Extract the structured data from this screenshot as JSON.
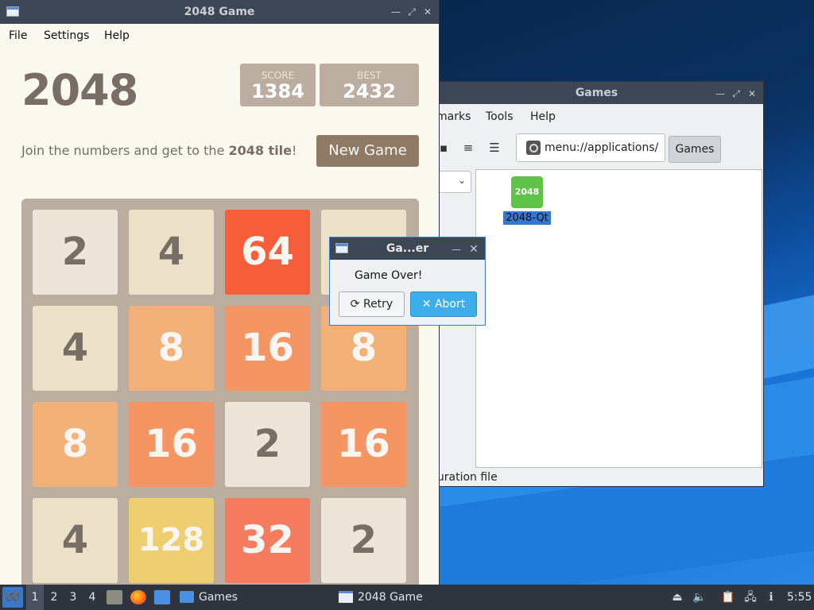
{
  "file_manager": {
    "title": "Games",
    "menu": [
      "marks",
      "Tools",
      "Help"
    ],
    "path": "menu://applications/",
    "breadcrumb": "Games",
    "file": {
      "icon_text": "2048",
      "name": "2048-Qt"
    },
    "status": "guration file"
  },
  "game": {
    "window_title": "2048 Game",
    "menu": [
      "File",
      "Settings",
      "Help"
    ],
    "title": "2048",
    "score_label": "SCORE",
    "score": "1384",
    "best_label": "BEST",
    "best": "2432",
    "intro_prefix": "Join the numbers and get to the ",
    "intro_bold": "2048 tile",
    "intro_suffix": "!",
    "new_game": "New Game",
    "tiles": [
      [
        "2",
        "4",
        "64",
        ""
      ],
      [
        "4",
        "8",
        "16",
        "8"
      ],
      [
        "8",
        "16",
        "2",
        "16"
      ],
      [
        "4",
        "128",
        "32",
        "2"
      ]
    ]
  },
  "dialog": {
    "title": "Ga...er",
    "message": "Game Over!",
    "retry": "Retry",
    "abort": "Abort"
  },
  "taskbar": {
    "workspaces": [
      "1",
      "2",
      "3",
      "4"
    ],
    "tasks": [
      "Games",
      "2048 Game"
    ],
    "clock": "5:55"
  },
  "colors": {
    "tile_2": "#eee4da",
    "tile_4": "#ede0c8",
    "tile_8": "#f2b179",
    "tile_16": "#f59563",
    "tile_32": "#f67c5f",
    "tile_64": "#f65e3b",
    "tile_128": "#edcf72"
  }
}
